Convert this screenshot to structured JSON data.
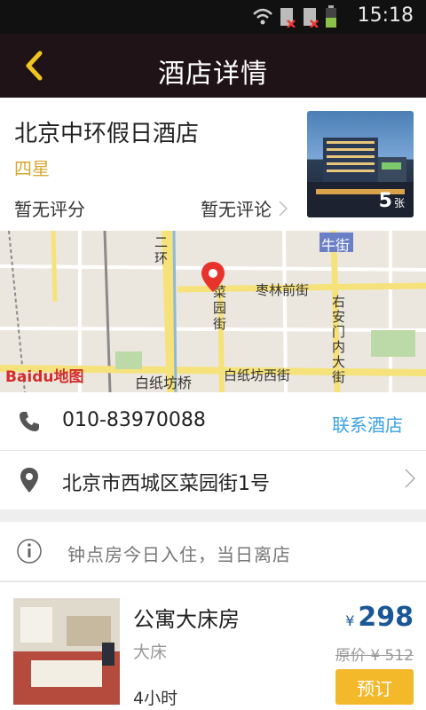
{
  "status_bar": {
    "time": "15:18"
  },
  "header": {
    "title": "酒店详情"
  },
  "hotel": {
    "name": "北京中环假日酒店",
    "star": "四星",
    "rating": "暂无评分",
    "reviews": "暂无评论",
    "photo_count": "5",
    "photo_unit": "张"
  },
  "map": {
    "labels": [
      "牛街",
      "二环",
      "枣林前街",
      "菜园街",
      "右安门内大街",
      "白纸坊桥",
      "白纸坊西街"
    ],
    "logo": "Baidu地图"
  },
  "contact": {
    "phone": "010-83970088",
    "link": "联系酒店",
    "address": "北京市西城区菜园街1号"
  },
  "notice": {
    "text": "钟点房今日入住，当日离店"
  },
  "room": {
    "name": "公寓大床房",
    "bed": "大床",
    "hours": "4小时",
    "currency": "¥",
    "price": "298",
    "original_price": "原价 ¥ 512",
    "book_label": "预订"
  }
}
